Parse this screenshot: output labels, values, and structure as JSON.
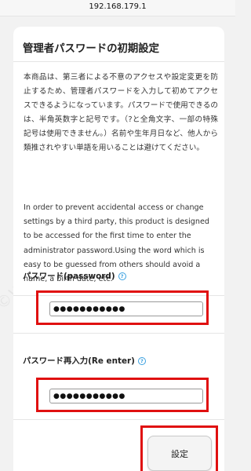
{
  "browser": {
    "url": "192.168.179.1"
  },
  "watermark": {
    "text": "©Wi-Fi Brand Lab · wifi-router.jp"
  },
  "form": {
    "title": "管理者パスワードの初期設定",
    "description_jp": "本商品は、第三者による不意のアクセスや設定変更を防止するため、管理者パスワードを入力して初めてアクセスできるようになっています。パスワードで使用できるのは、半角英数字と記号です。（?と全角文字、一部の特殊記号は使用できません。）名前や生年月日など、他人から類推されやすい単語を用いることは避けてください。",
    "description_en": "In order to prevent accidental access or change settings by a third party,  this product is designed to be accessed for the first time to enter the administrator password.Using the word which is easy to be guessed from others should avoid a name,  a birth date,  etc.",
    "password_label": "パスワード(password)",
    "password_value": "●●●●●●●●●●●",
    "reenter_label": "パスワード再入力(Re enter)",
    "reenter_value": "●●●●●●●●●●●",
    "help_icon_glyph": "?",
    "submit_label": "設定"
  },
  "colors": {
    "highlight_border": "#e01010",
    "help_icon": "#3aa0e0",
    "page_background": "#f2f2f2"
  },
  "icons": {
    "help": "question-mark-circle-icon"
  }
}
